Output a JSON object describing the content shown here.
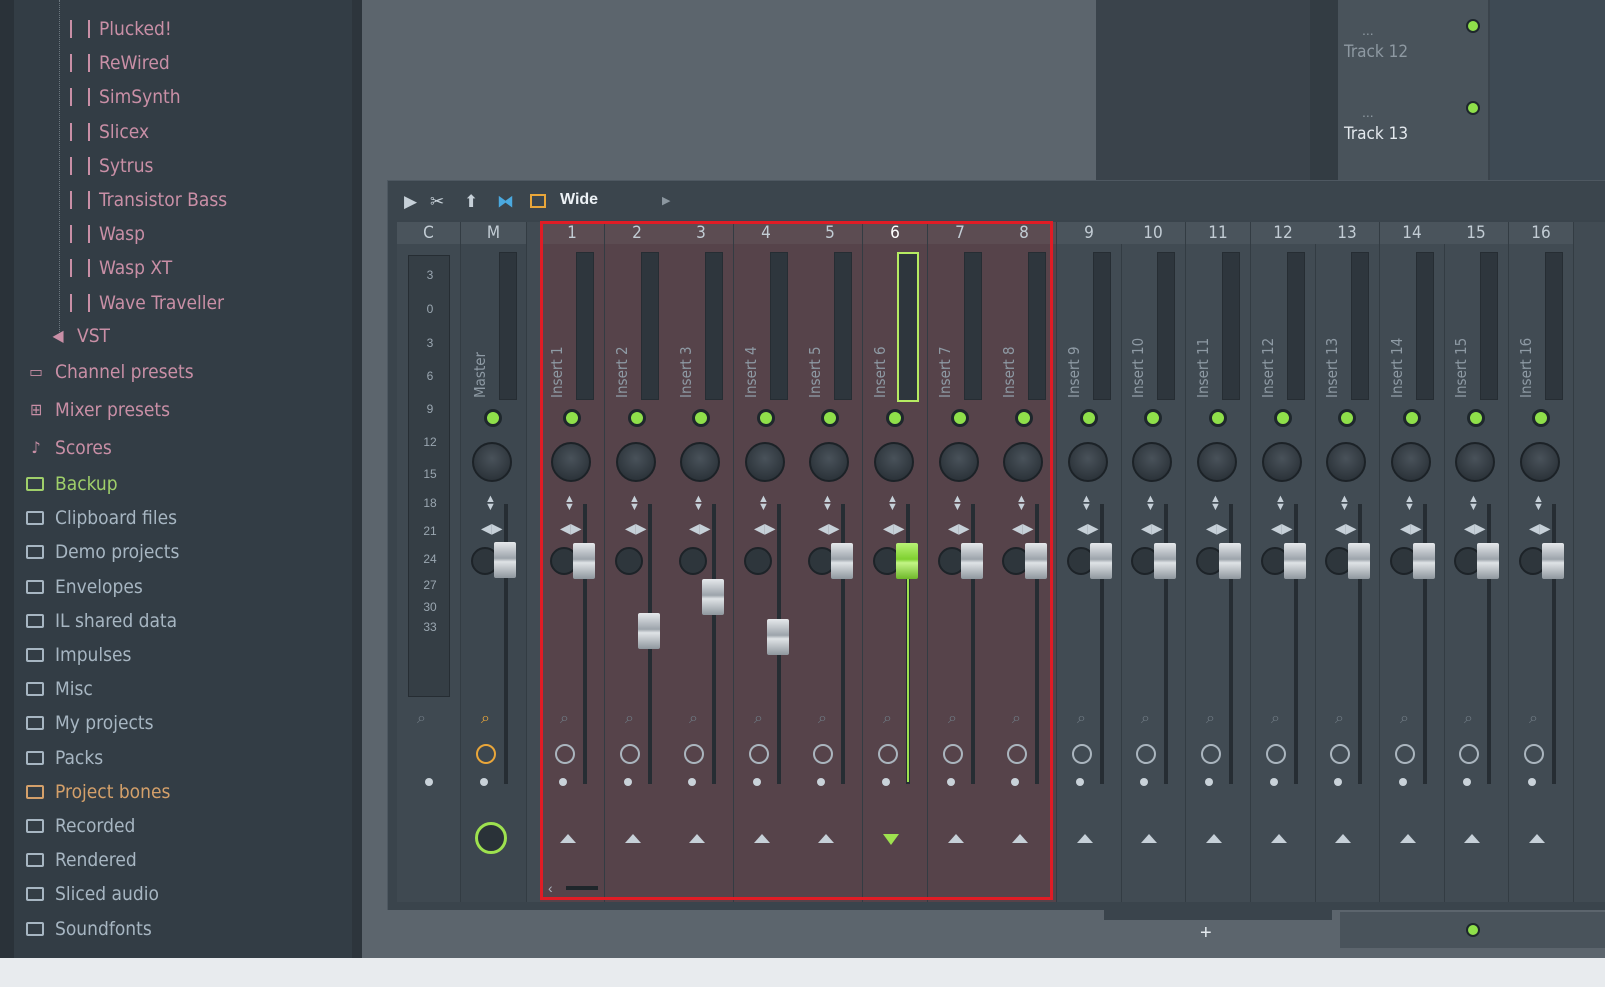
{
  "browser": {
    "plugins": [
      "Plucked!",
      "ReWired",
      "SimSynth",
      "Slicex",
      "Sytrus",
      "Transistor Bass",
      "Wasp",
      "Wasp XT",
      "Wave Traveller"
    ],
    "vst_label": "VST",
    "presets": [
      {
        "label": "Channel presets",
        "icon": "channel-preset-icon"
      },
      {
        "label": "Mixer presets",
        "icon": "mixer-preset-icon"
      },
      {
        "label": "Scores",
        "icon": "note-icon"
      }
    ],
    "folders": [
      {
        "label": "Backup",
        "style": "green",
        "icon": "backup-icon"
      },
      {
        "label": "Clipboard files",
        "style": "folder",
        "icon": "folder-icon"
      },
      {
        "label": "Demo projects",
        "style": "folder",
        "icon": "folder-icon"
      },
      {
        "label": "Envelopes",
        "style": "folder",
        "icon": "folder-icon"
      },
      {
        "label": "IL shared data",
        "style": "folder",
        "icon": "folder-icon"
      },
      {
        "label": "Impulses",
        "style": "folder",
        "icon": "folder-icon"
      },
      {
        "label": "Misc",
        "style": "folder",
        "icon": "folder-icon"
      },
      {
        "label": "My projects",
        "style": "folder",
        "icon": "folder-icon"
      },
      {
        "label": "Packs",
        "style": "folder",
        "icon": "packs-icon"
      },
      {
        "label": "Project bones",
        "style": "orange",
        "icon": "folder-icon"
      },
      {
        "label": "Recorded",
        "style": "folder",
        "icon": "waveform-icon"
      },
      {
        "label": "Rendered",
        "style": "folder",
        "icon": "rendered-icon"
      },
      {
        "label": "Sliced audio",
        "style": "folder",
        "icon": "waveform-icon"
      },
      {
        "label": "Soundfonts",
        "style": "folder",
        "icon": "folder-icon"
      }
    ]
  },
  "playlist": {
    "tracks": [
      "Track 12",
      "Track 13"
    ],
    "track_dots": "..."
  },
  "mixer": {
    "toolbar": {
      "view_mode": "Wide"
    },
    "headers": {
      "current": "C",
      "master": "M"
    },
    "master_label": "Master",
    "db_scale": [
      "3",
      "0",
      "3",
      "6",
      "9",
      "12",
      "15",
      "18",
      "21",
      "24",
      "27",
      "30",
      "33"
    ],
    "inserts": [
      {
        "num": "1",
        "label": "Insert 1",
        "fader_level": 0.95
      },
      {
        "num": "2",
        "label": "Insert 2",
        "fader_level": 0.7
      },
      {
        "num": "3",
        "label": "Insert 3",
        "fader_level": 0.82
      },
      {
        "num": "4",
        "label": "Insert 4",
        "fader_level": 0.68
      },
      {
        "num": "5",
        "label": "Insert 5",
        "fader_level": 0.95
      },
      {
        "num": "6",
        "label": "Insert 6",
        "fader_level": 0.95
      },
      {
        "num": "7",
        "label": "Insert 7",
        "fader_level": 0.95
      },
      {
        "num": "8",
        "label": "Insert 8",
        "fader_level": 0.95
      },
      {
        "num": "9",
        "label": "Insert 9",
        "fader_level": 0.95
      },
      {
        "num": "10",
        "label": "Insert 10",
        "fader_level": 0.95
      },
      {
        "num": "11",
        "label": "Insert 11",
        "fader_level": 0.95
      },
      {
        "num": "12",
        "label": "Insert 12",
        "fader_level": 0.95
      },
      {
        "num": "13",
        "label": "Insert 13",
        "fader_level": 0.95
      },
      {
        "num": "14",
        "label": "Insert 14",
        "fader_level": 0.95
      },
      {
        "num": "15",
        "label": "Insert 15",
        "fader_level": 0.95
      },
      {
        "num": "16",
        "label": "Insert 16",
        "fader_level": 0.95
      }
    ],
    "selected_range": "1-8",
    "active_insert": "6",
    "colors": {
      "selection": "#e01c25",
      "led": "#8fe04a",
      "active": "#9ee24f"
    }
  },
  "add_track_label": "+"
}
